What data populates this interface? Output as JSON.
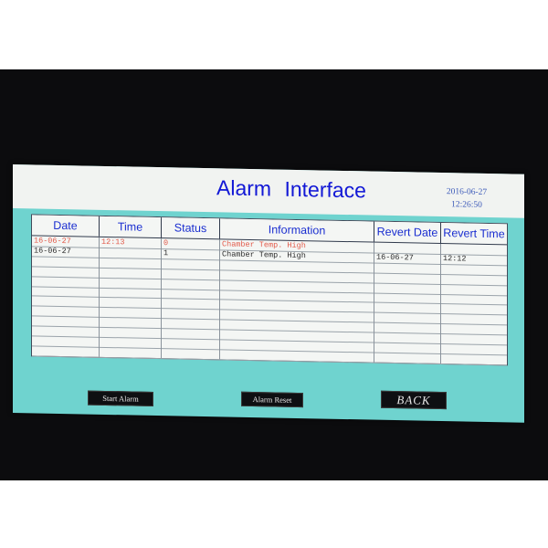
{
  "header": {
    "title": "Alarm  Interface",
    "date": "2016-06-27",
    "time": "12:26:50"
  },
  "table": {
    "columns": [
      "Date",
      "Time",
      "Status",
      "Information",
      "Revert Date",
      "Revert Time"
    ],
    "rows": [
      {
        "date": "16-06-27",
        "time": "12:13",
        "status": "0",
        "information": "Chamber Temp. High",
        "revert_date": "",
        "revert_time": "",
        "color": "#e25a4a"
      },
      {
        "date": "16-06-27",
        "time": "",
        "status": "1",
        "information": "Chamber Temp. High",
        "revert_date": "16-06-27",
        "revert_time": "12:12",
        "color": "#2a2a2a"
      }
    ],
    "empty_rows": 10
  },
  "buttons": {
    "start_alarm": "Start Alarm",
    "alarm_reset": "Alarm Reset",
    "back": "BACK"
  },
  "colors": {
    "screen_background": "#6fd3cf",
    "header_text": "#1218d6",
    "active_alarm": "#e25a4a"
  }
}
